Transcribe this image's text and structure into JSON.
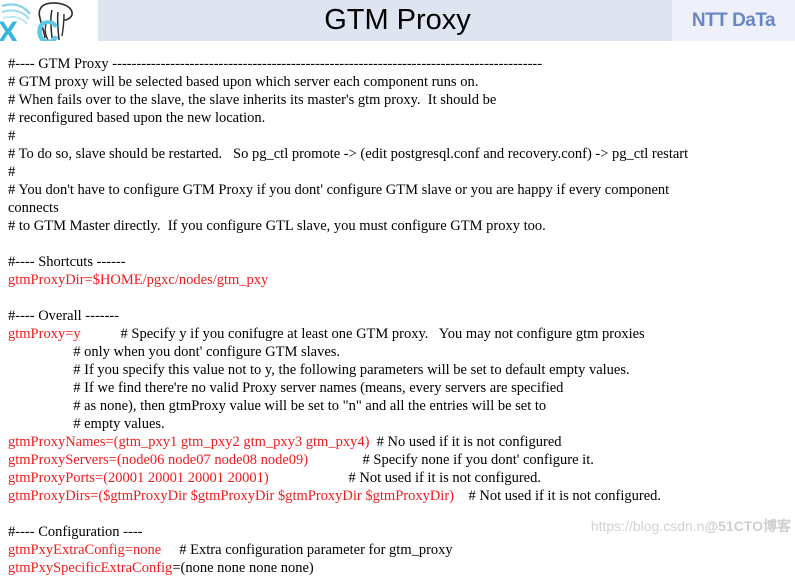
{
  "header": {
    "title": "GTM Proxy",
    "brand_logo_label": "postgres-xc-logo",
    "ntt_logo_text": "NTT DaTa"
  },
  "watermark": {
    "url_text": "https://blog.csdn.n",
    "site_text": "@51CTO博客"
  },
  "colors": {
    "header_band": "#dfe4f1",
    "ntt_panel": "#eef1fa",
    "ntt_blue": "#6b86c4",
    "param_red": "#ee1c1c",
    "comment_black": "#000000",
    "watermark_gray": "#d2d2d2"
  },
  "code": {
    "lines": [
      {
        "id": "l01",
        "segments": [
          {
            "color": "black",
            "text": "#---- GTM Proxy -----------------------------------------------------------------------------------------"
          }
        ]
      },
      {
        "id": "l02",
        "segments": [
          {
            "color": "black",
            "text": "# GTM proxy will be selected based upon which server each component runs on."
          }
        ]
      },
      {
        "id": "l03",
        "segments": [
          {
            "color": "black",
            "text": "# When fails over to the slave, the slave inherits its master's gtm proxy.  It should be"
          }
        ]
      },
      {
        "id": "l04",
        "segments": [
          {
            "color": "black",
            "text": "# reconfigured based upon the new location."
          }
        ]
      },
      {
        "id": "l05",
        "segments": [
          {
            "color": "black",
            "text": "#"
          }
        ]
      },
      {
        "id": "l06",
        "segments": [
          {
            "color": "black",
            "text": "# To do so, slave should be restarted.   So pg_ctl promote -> (edit postgresql.conf and recovery.conf) -> pg_ctl restart"
          }
        ]
      },
      {
        "id": "l07",
        "segments": [
          {
            "color": "black",
            "text": "#"
          }
        ]
      },
      {
        "id": "l08",
        "segments": [
          {
            "color": "black",
            "text": "# You don't have to configure GTM Proxy if you dont' configure GTM slave or you are happy if every component"
          }
        ]
      },
      {
        "id": "l09",
        "segments": [
          {
            "color": "black",
            "text": "connects"
          }
        ]
      },
      {
        "id": "l10",
        "segments": [
          {
            "color": "black",
            "text": "# to GTM Master directly.  If you configure GTL slave, you must configure GTM proxy too."
          }
        ]
      },
      {
        "id": "l11",
        "segments": [
          {
            "color": "black",
            "text": ""
          }
        ]
      },
      {
        "id": "l12",
        "segments": [
          {
            "color": "black",
            "text": "#---- Shortcuts ------"
          }
        ]
      },
      {
        "id": "l13",
        "segments": [
          {
            "color": "red",
            "text": "gtmProxyDir=$HOME/pgxc/nodes/gtm_pxy"
          }
        ]
      },
      {
        "id": "l14",
        "segments": [
          {
            "color": "black",
            "text": ""
          }
        ]
      },
      {
        "id": "l15",
        "segments": [
          {
            "color": "black",
            "text": "#---- Overall -------"
          }
        ]
      },
      {
        "id": "l16",
        "segments": [
          {
            "color": "red",
            "text": "gtmProxy=y"
          },
          {
            "color": "black",
            "text": "           # Specify y if you conifugre at least one GTM proxy.   You may not configure gtm proxies"
          }
        ]
      },
      {
        "id": "l17",
        "segments": [
          {
            "color": "black",
            "text": "                  # only when you dont' configure GTM slaves."
          }
        ]
      },
      {
        "id": "l18",
        "segments": [
          {
            "color": "black",
            "text": "                  # If you specify this value not to y, the following parameters will be set to default empty values."
          }
        ]
      },
      {
        "id": "l19",
        "segments": [
          {
            "color": "black",
            "text": "                  # If we find there're no valid Proxy server names (means, every servers are specified"
          }
        ]
      },
      {
        "id": "l20",
        "segments": [
          {
            "color": "black",
            "text": "                  # as none), then gtmProxy value will be set to \"n\" and all the entries will be set to"
          }
        ]
      },
      {
        "id": "l21",
        "segments": [
          {
            "color": "black",
            "text": "                  # empty values."
          }
        ]
      },
      {
        "id": "l22",
        "segments": [
          {
            "color": "red",
            "text": "gtmProxyNames=(gtm_pxy1 gtm_pxy2 gtm_pxy3 gtm_pxy4)"
          },
          {
            "color": "black",
            "text": "  # No used if it is not configured"
          }
        ]
      },
      {
        "id": "l23",
        "segments": [
          {
            "color": "red",
            "text": "gtmProxyServers=(node06 node07 node08 node09)"
          },
          {
            "color": "black",
            "text": "               # Specify none if you dont' configure it."
          }
        ]
      },
      {
        "id": "l24",
        "segments": [
          {
            "color": "red",
            "text": "gtmProxyPorts=(20001 20001 20001 20001)"
          },
          {
            "color": "black",
            "text": "                      # Not used if it is not configured."
          }
        ]
      },
      {
        "id": "l25",
        "segments": [
          {
            "color": "red",
            "text": "gtmProxyDirs=($gtmProxyDir $gtmProxyDir $gtmProxyDir $gtmProxyDir)"
          },
          {
            "color": "black",
            "text": "    # Not used if it is not configured."
          }
        ]
      },
      {
        "id": "l26",
        "segments": [
          {
            "color": "black",
            "text": ""
          }
        ]
      },
      {
        "id": "l27",
        "segments": [
          {
            "color": "black",
            "text": "#---- Configuration ----"
          }
        ]
      },
      {
        "id": "l28",
        "segments": [
          {
            "color": "red",
            "text": "gtmPxyExtraConfig=none"
          },
          {
            "color": "black",
            "text": "     # Extra configuration parameter for gtm_proxy"
          }
        ]
      },
      {
        "id": "l29",
        "segments": [
          {
            "color": "red",
            "text": "gtmPxySpecificExtraConfig"
          },
          {
            "color": "black",
            "text": "=(none none none none)"
          }
        ]
      }
    ]
  }
}
